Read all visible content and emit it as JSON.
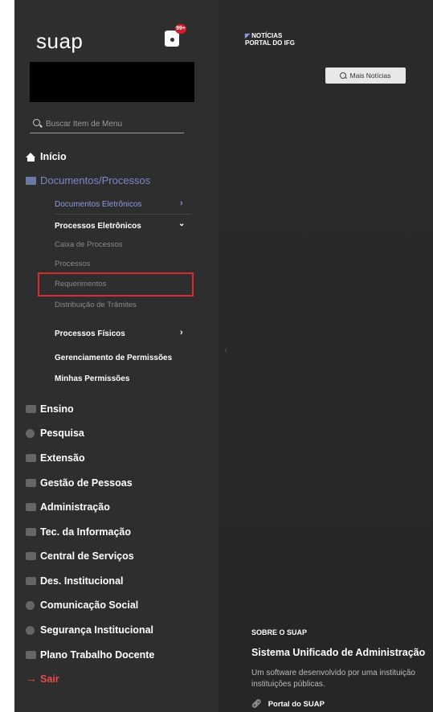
{
  "header": {
    "logo": "suap",
    "notification_count": "99+"
  },
  "search": {
    "placeholder": "Buscar Item de Menu"
  },
  "menu": {
    "home": "Início",
    "documents": "Documentos/Processos",
    "documents_sub": {
      "electronic_docs": "Documentos Eletrônicos",
      "electronic_processes": "Processos Eletrônicos",
      "process_box": "Caixa de Processos",
      "processes": "Processos",
      "requests": "Requerimentos",
      "distribution": "Distribuição de Trâmites",
      "physical_processes": "Processos Físicos",
      "permissions_mgmt": "Gerenciamento de Permissões",
      "my_permissions": "Minhas Permissões"
    },
    "items": [
      "Ensino",
      "Pesquisa",
      "Extensão",
      "Gestão de Pessoas",
      "Administração",
      "Tec. da Informação",
      "Central de Serviços",
      "Des. Institucional",
      "Comunicação Social",
      "Segurança Institucional",
      "Plano Trabalho Docente"
    ],
    "logout": "Sair"
  },
  "news": {
    "line1": "NOTÍCIAS",
    "line2": "PORTAL DO IFG",
    "more_button": "Mais Notícias"
  },
  "about": {
    "title": "SOBRE O SUAP",
    "heading": "Sistema Unificado de Administração",
    "description_line1": "Um software desenvolvido por uma instituição",
    "description_line2": "instituições públicas.",
    "link": "Portal do SUAP"
  },
  "colors": {
    "sidebar_bg": "#2e2e2e",
    "accent_blue": "#7a89c8",
    "highlight_red": "#d92c2c",
    "logout_red": "#e64a4a"
  }
}
